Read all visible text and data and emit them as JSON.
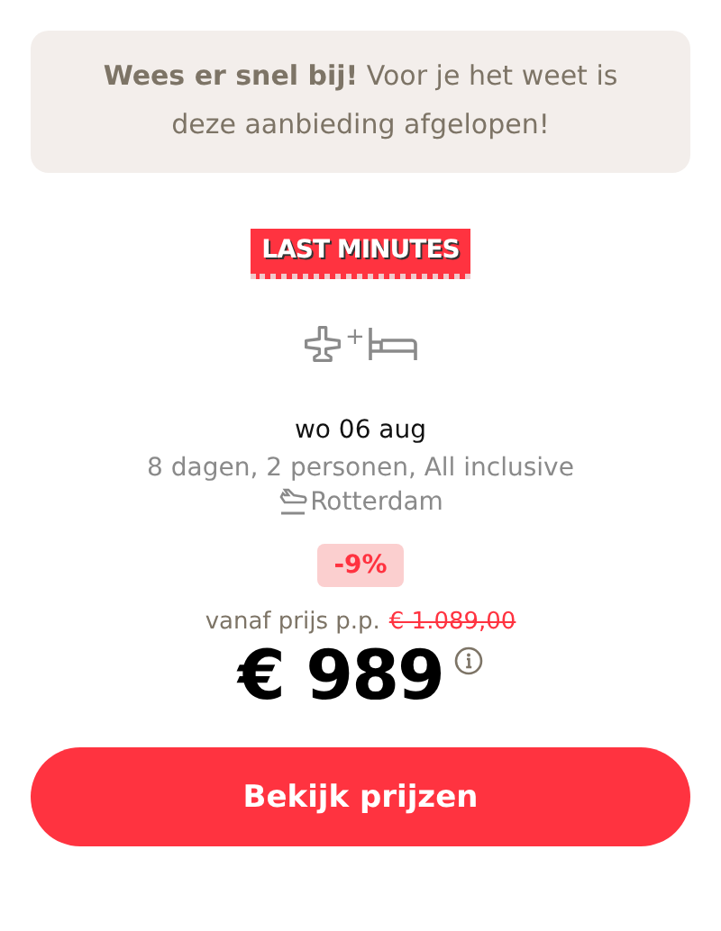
{
  "notice": "**Wees er snel bij!** Voor je het weet is deze aanbieding afgelopen!",
  "badge": "LAST MINUTES",
  "travel_type": {
    "joiner": "+"
  },
  "date": "wo 06 aug",
  "details": "8 dagen, 2 personen, All inclusive",
  "departure": "Rotterdam",
  "discount": "-9%",
  "price_label": "vanaf prijs p.p.",
  "old_price": "€ 1.089,00",
  "price": "€ 989",
  "button": "Bekijk prijzen"
}
